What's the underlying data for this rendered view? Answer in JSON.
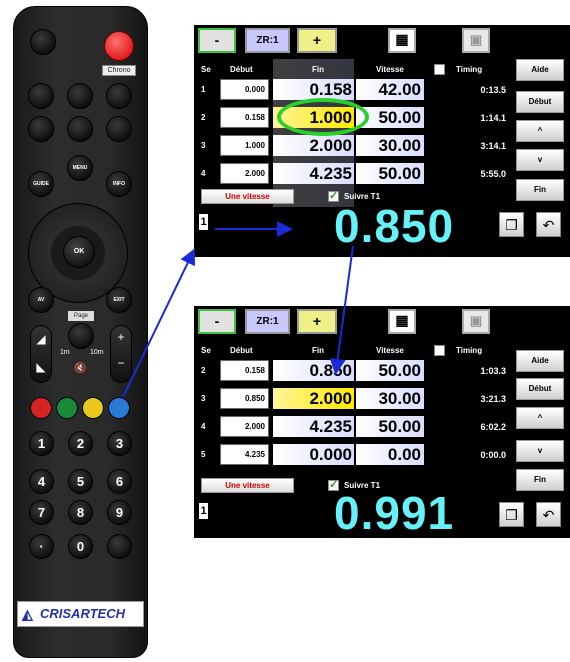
{
  "remote": {
    "chrono_label": "Chrono",
    "guide_label": "GUIDE",
    "menu_label": "MENU",
    "info_label": "INFO",
    "ok_label": "OK",
    "av_label": "AV",
    "exit_label": "EXIT",
    "page_label": "Page",
    "vol_plus": "+",
    "vol_minus": "−",
    "num_1m": "1m",
    "num_10m": "10m",
    "brand": "CRISARTECH",
    "colors": [
      "#d42424",
      "#1a8a3a",
      "#e8c81a",
      "#2a7ad8"
    ],
    "digits": [
      "1",
      "2",
      "3",
      "4",
      "5",
      "6",
      "7",
      "8",
      "9",
      "·",
      "0",
      ""
    ]
  },
  "screen_top": {
    "toolbar": {
      "minus": "-",
      "zr": "ZR:1",
      "plus": "+"
    },
    "headers": {
      "se": "Se",
      "debut": "Début",
      "fin": "Fin",
      "vitesse": "Vitesse",
      "timing": "Timing"
    },
    "rows": [
      {
        "se": "1",
        "debut": "0.000",
        "fin": "0.158",
        "vitesse": "42.00",
        "timing": "0:13.5"
      },
      {
        "se": "2",
        "debut": "0.158",
        "fin": "1.000",
        "vitesse": "50.00",
        "timing": "1:14.1"
      },
      {
        "se": "3",
        "debut": "1.000",
        "fin": "2.000",
        "vitesse": "30.00",
        "timing": "3:14.1"
      },
      {
        "se": "4",
        "debut": "2.000",
        "fin": "4.235",
        "vitesse": "50.00",
        "timing": "5:55.0"
      }
    ],
    "side_buttons": [
      "Aide",
      "Début",
      "^",
      "v",
      "Fin"
    ],
    "une_vitesse": "Une vitesse",
    "suivre": "Suivre T1",
    "lap": "1",
    "value": "0.850"
  },
  "screen_bottom": {
    "toolbar": {
      "minus": "-",
      "zr": "ZR:1",
      "plus": "+"
    },
    "headers": {
      "se": "Se",
      "debut": "Début",
      "fin": "Fin",
      "vitesse": "Vitesse",
      "timing": "Timing"
    },
    "rows": [
      {
        "se": "2",
        "debut": "0.158",
        "fin": "0.850",
        "vitesse": "50.00",
        "timing": "1:03.3"
      },
      {
        "se": "3",
        "debut": "0.850",
        "fin": "2.000",
        "vitesse": "30.00",
        "timing": "3:21.3"
      },
      {
        "se": "4",
        "debut": "2.000",
        "fin": "4.235",
        "vitesse": "50.00",
        "timing": "6:02.2"
      },
      {
        "se": "5",
        "debut": "4.235",
        "fin": "0.000",
        "vitesse": "0.00",
        "timing": "0:00.0"
      }
    ],
    "side_buttons": [
      "Aide",
      "Début",
      "^",
      "v",
      "Fin"
    ],
    "une_vitesse": "Une vitesse",
    "suivre": "Suivre T1",
    "lap": "1",
    "value": "0.991"
  },
  "colors": {
    "accent_cyan": "#66f0f8",
    "highlight_yellow": "#ffe800",
    "circle_green": "#2ad02a",
    "arrow_blue": "#1a2ad8"
  }
}
